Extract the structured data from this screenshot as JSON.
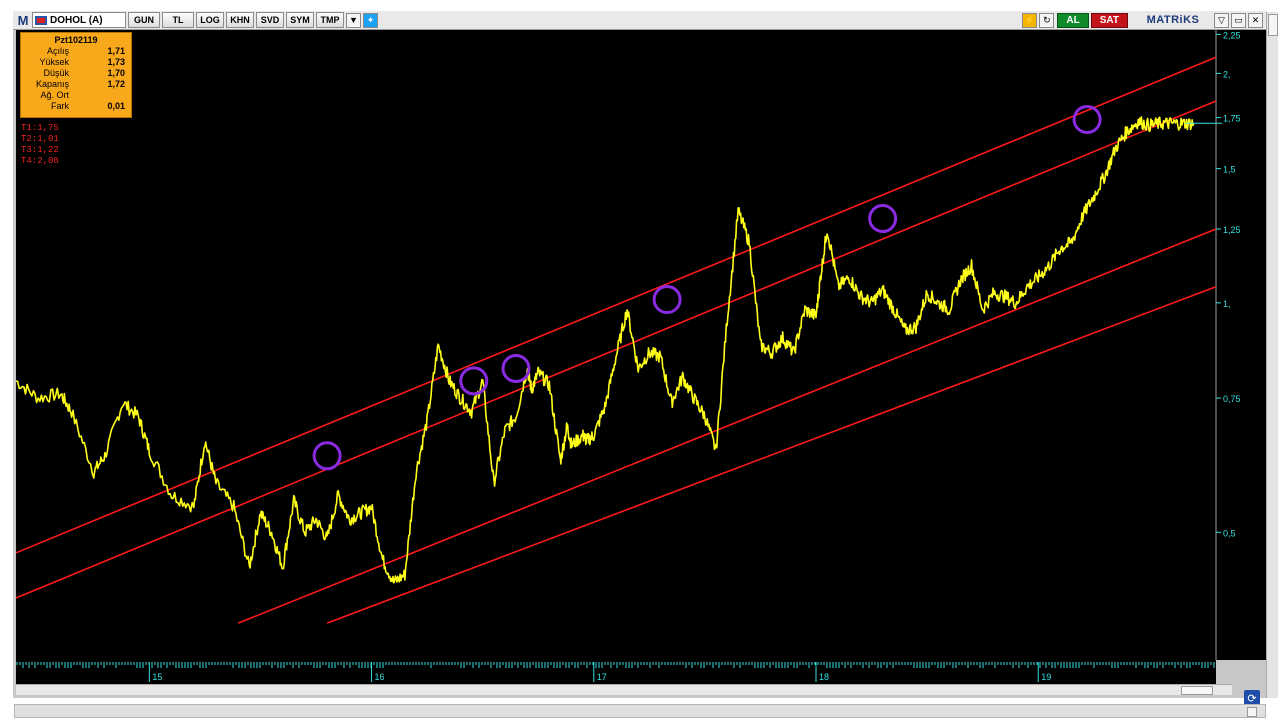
{
  "toolbar": {
    "logo": "M",
    "symbol": "DOHOL (A)",
    "buttons": [
      "GUN",
      "TL",
      "LOG",
      "KHN",
      "SVD",
      "SYM",
      "TMP"
    ],
    "al_label": "AL",
    "sat_label": "SAT",
    "brand": "MATRiKS"
  },
  "info": {
    "header": "Pzt102119",
    "rows": [
      {
        "label": "Açılış",
        "value": "1,71"
      },
      {
        "label": "Yüksek",
        "value": "1,73"
      },
      {
        "label": "Düşük",
        "value": "1,70"
      },
      {
        "label": "Kapanış",
        "value": "1,72"
      },
      {
        "label": "Ağ. Ort",
        "value": ""
      },
      {
        "label": "Fark",
        "value": "0,01"
      }
    ]
  },
  "trend_values": [
    "T1:1,75",
    "T2:1,01",
    "T3:1,22",
    "T4:2,08"
  ],
  "colors": {
    "background": "#000000",
    "price": "#ffff1a",
    "channel": "#ff1a1a",
    "marker": "#8a2be2",
    "axis": "#33e0e0"
  },
  "chart_data": {
    "type": "line",
    "scale": "log",
    "y_ticks": [
      {
        "value": 2.25,
        "label": "2,25"
      },
      {
        "value": 2.0,
        "label": "2,"
      },
      {
        "value": 1.75,
        "label": "1,75"
      },
      {
        "value": 1.5,
        "label": "1,5"
      },
      {
        "value": 1.25,
        "label": "1,25"
      },
      {
        "value": 1.0,
        "label": "1,"
      },
      {
        "value": 0.75,
        "label": "0,75"
      },
      {
        "value": 0.5,
        "label": "0,5"
      }
    ],
    "x_ticks": [
      "15",
      "16",
      "17",
      "18",
      "19"
    ],
    "ylim": [
      0.34,
      2.28
    ],
    "xlim": [
      14.4,
      19.8
    ],
    "last_value": 1.72,
    "series": [
      {
        "x": [
          14.4,
          14.5,
          14.6,
          14.65,
          14.75,
          14.8,
          14.88,
          14.95,
          15.0,
          15.1,
          15.2,
          15.25,
          15.3,
          15.38,
          15.45,
          15.5,
          15.55,
          15.6,
          15.65,
          15.7,
          15.75,
          15.8,
          15.85,
          15.9,
          15.95,
          16.0,
          16.05,
          16.1,
          16.15,
          16.2,
          16.25,
          16.3,
          16.35,
          16.4,
          16.45,
          16.5,
          16.55,
          16.6,
          16.65,
          16.7,
          16.72,
          16.75,
          16.8,
          16.85,
          16.88,
          16.9,
          16.95,
          16.97,
          17.0,
          17.05,
          17.1,
          17.15,
          17.2,
          17.25,
          17.3,
          17.35,
          17.4,
          17.45,
          17.5,
          17.55,
          17.6,
          17.65,
          17.7,
          17.75,
          17.8,
          17.85,
          17.9,
          17.95,
          18.0,
          18.02,
          18.05,
          18.1,
          18.15,
          18.2,
          18.25,
          18.3,
          18.35,
          18.4,
          18.45,
          18.5,
          18.55,
          18.6,
          18.65,
          18.7,
          18.75,
          18.8,
          18.85,
          18.9,
          18.95,
          19.0,
          19.05,
          19.1,
          19.15,
          19.2,
          19.25,
          19.3,
          19.35,
          19.4,
          19.45,
          19.5,
          19.55,
          19.6,
          19.65,
          19.7
        ],
        "y": [
          0.79,
          0.75,
          0.76,
          0.72,
          0.6,
          0.63,
          0.74,
          0.71,
          0.64,
          0.56,
          0.54,
          0.66,
          0.58,
          0.54,
          0.45,
          0.53,
          0.5,
          0.45,
          0.55,
          0.5,
          0.52,
          0.49,
          0.56,
          0.52,
          0.53,
          0.54,
          0.46,
          0.43,
          0.44,
          0.6,
          0.7,
          0.88,
          0.79,
          0.75,
          0.72,
          0.79,
          0.58,
          0.68,
          0.71,
          0.82,
          0.77,
          0.81,
          0.78,
          0.62,
          0.69,
          0.65,
          0.67,
          0.66,
          0.67,
          0.73,
          0.85,
          0.98,
          0.82,
          0.86,
          0.85,
          0.74,
          0.8,
          0.75,
          0.71,
          0.64,
          0.95,
          1.32,
          1.2,
          0.88,
          0.86,
          0.9,
          0.86,
          0.98,
          0.96,
          1.08,
          1.25,
          1.05,
          1.08,
          1.02,
          1.0,
          1.04,
          0.98,
          0.92,
          0.93,
          1.03,
          1.0,
          0.98,
          1.07,
          1.12,
          0.98,
          1.03,
          1.02,
          1.0,
          1.05,
          1.08,
          1.12,
          1.18,
          1.2,
          1.3,
          1.38,
          1.47,
          1.6,
          1.68,
          1.73,
          1.71,
          1.72,
          1.72,
          1.72,
          1.72
        ]
      }
    ],
    "channel_lines": [
      {
        "x": [
          14.4,
          19.8
        ],
        "y": [
          0.47,
          2.1
        ]
      },
      {
        "x": [
          14.4,
          19.8
        ],
        "y": [
          0.41,
          1.84
        ]
      },
      {
        "x": [
          15.4,
          19.8
        ],
        "y": [
          0.38,
          1.25
        ]
      },
      {
        "x": [
          15.8,
          19.8
        ],
        "y": [
          0.38,
          1.05
        ]
      }
    ],
    "markers": [
      {
        "x": 15.8,
        "y": 0.63
      },
      {
        "x": 16.46,
        "y": 0.79
      },
      {
        "x": 16.65,
        "y": 0.82
      },
      {
        "x": 17.33,
        "y": 1.01
      },
      {
        "x": 18.3,
        "y": 1.29
      },
      {
        "x": 19.22,
        "y": 1.74
      }
    ]
  }
}
